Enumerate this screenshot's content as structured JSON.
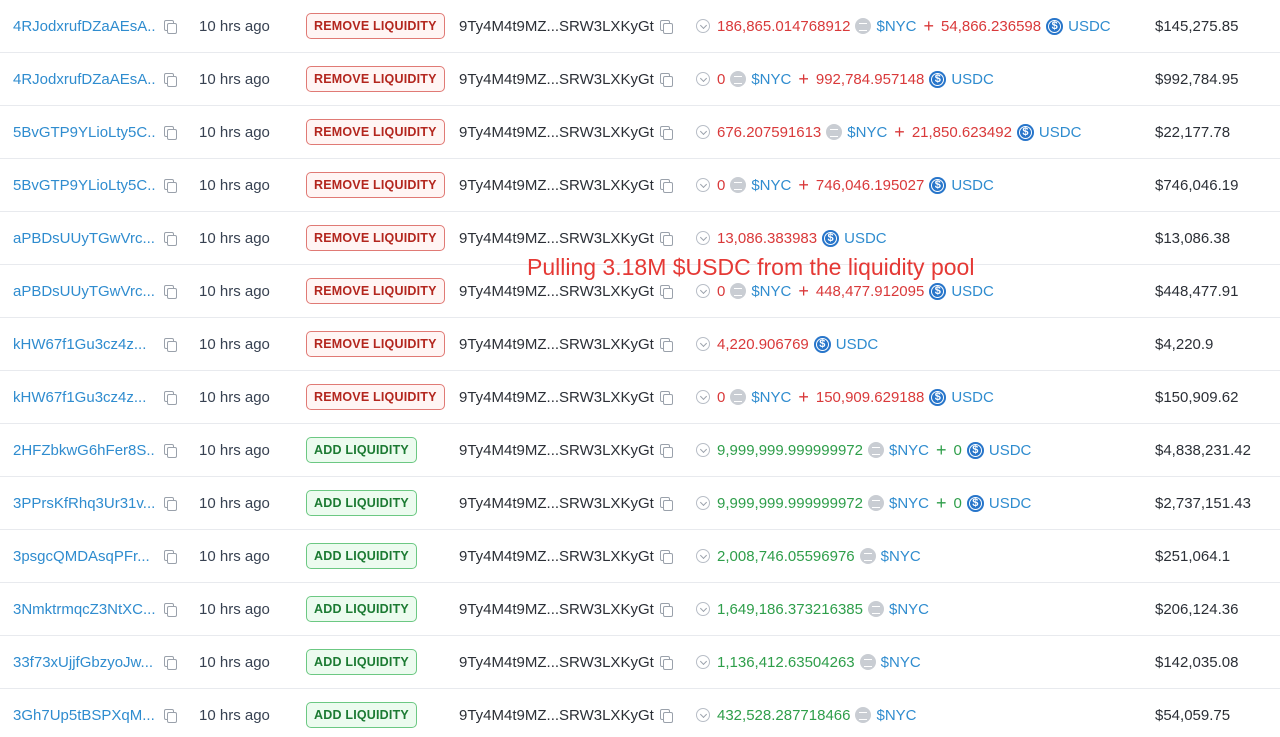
{
  "overlay_text": "Pulling 3.18M $USDC from the liquidity pool",
  "icons": {
    "copy": "copy-icon",
    "expand": "chevron-down-icon",
    "nyc_token": "nyc-token-icon",
    "usdc_token": "usdc-token-icon"
  },
  "colors": {
    "link": "#2f8ccf",
    "remove": "#b3261e",
    "add": "#1b7a32",
    "negative": "#d9393a",
    "positive": "#2e9e4a"
  },
  "rows": [
    {
      "sig": "4RJodxrufDZaAEsA...",
      "time": "10 hrs ago",
      "type": "REMOVE LIQUIDITY",
      "kind": "remove",
      "account": "9Ty4M4t9MZ...SRW3LXKyGt",
      "tokens": [
        {
          "amount": "186,865.014768912",
          "symbol": "$NYC",
          "icon": "nyc"
        },
        {
          "amount": "54,866.236598",
          "symbol": "USDC",
          "icon": "usdc"
        }
      ],
      "value": "$145,275.85"
    },
    {
      "sig": "4RJodxrufDZaAEsA...",
      "time": "10 hrs ago",
      "type": "REMOVE LIQUIDITY",
      "kind": "remove",
      "account": "9Ty4M4t9MZ...SRW3LXKyGt",
      "tokens": [
        {
          "amount": "0",
          "symbol": "$NYC",
          "icon": "nyc"
        },
        {
          "amount": "992,784.957148",
          "symbol": "USDC",
          "icon": "usdc"
        }
      ],
      "value": "$992,784.95"
    },
    {
      "sig": "5BvGTP9YLioLty5C...",
      "time": "10 hrs ago",
      "type": "REMOVE LIQUIDITY",
      "kind": "remove",
      "account": "9Ty4M4t9MZ...SRW3LXKyGt",
      "tokens": [
        {
          "amount": "676.207591613",
          "symbol": "$NYC",
          "icon": "nyc"
        },
        {
          "amount": "21,850.623492",
          "symbol": "USDC",
          "icon": "usdc"
        }
      ],
      "value": "$22,177.78"
    },
    {
      "sig": "5BvGTP9YLioLty5C...",
      "time": "10 hrs ago",
      "type": "REMOVE LIQUIDITY",
      "kind": "remove",
      "account": "9Ty4M4t9MZ...SRW3LXKyGt",
      "tokens": [
        {
          "amount": "0",
          "symbol": "$NYC",
          "icon": "nyc"
        },
        {
          "amount": "746,046.195027",
          "symbol": "USDC",
          "icon": "usdc"
        }
      ],
      "value": "$746,046.19"
    },
    {
      "sig": "aPBDsUUyTGwVrc...",
      "time": "10 hrs ago",
      "type": "REMOVE LIQUIDITY",
      "kind": "remove",
      "account": "9Ty4M4t9MZ...SRW3LXKyGt",
      "tokens": [
        {
          "amount": "13,086.383983",
          "symbol": "USDC",
          "icon": "usdc"
        }
      ],
      "value": "$13,086.38"
    },
    {
      "sig": "aPBDsUUyTGwVrc...",
      "time": "10 hrs ago",
      "type": "REMOVE LIQUIDITY",
      "kind": "remove",
      "account": "9Ty4M4t9MZ...SRW3LXKyGt",
      "tokens": [
        {
          "amount": "0",
          "symbol": "$NYC",
          "icon": "nyc"
        },
        {
          "amount": "448,477.912095",
          "symbol": "USDC",
          "icon": "usdc"
        }
      ],
      "value": "$448,477.91"
    },
    {
      "sig": "kHW67f1Gu3cz4z...",
      "time": "10 hrs ago",
      "type": "REMOVE LIQUIDITY",
      "kind": "remove",
      "account": "9Ty4M4t9MZ...SRW3LXKyGt",
      "tokens": [
        {
          "amount": "4,220.906769",
          "symbol": "USDC",
          "icon": "usdc"
        }
      ],
      "value": "$4,220.9"
    },
    {
      "sig": "kHW67f1Gu3cz4z...",
      "time": "10 hrs ago",
      "type": "REMOVE LIQUIDITY",
      "kind": "remove",
      "account": "9Ty4M4t9MZ...SRW3LXKyGt",
      "tokens": [
        {
          "amount": "0",
          "symbol": "$NYC",
          "icon": "nyc"
        },
        {
          "amount": "150,909.629188",
          "symbol": "USDC",
          "icon": "usdc"
        }
      ],
      "value": "$150,909.62"
    },
    {
      "sig": "2HFZbkwG6hFer8S...",
      "time": "10 hrs ago",
      "type": "ADD LIQUIDITY",
      "kind": "add",
      "account": "9Ty4M4t9MZ...SRW3LXKyGt",
      "tokens": [
        {
          "amount": "9,999,999.999999972",
          "symbol": "$NYC",
          "icon": "nyc"
        },
        {
          "amount": "0",
          "symbol": "USDC",
          "icon": "usdc"
        }
      ],
      "value": "$4,838,231.42"
    },
    {
      "sig": "3PPrsKfRhq3Ur31v...",
      "time": "10 hrs ago",
      "type": "ADD LIQUIDITY",
      "kind": "add",
      "account": "9Ty4M4t9MZ...SRW3LXKyGt",
      "tokens": [
        {
          "amount": "9,999,999.999999972",
          "symbol": "$NYC",
          "icon": "nyc"
        },
        {
          "amount": "0",
          "symbol": "USDC",
          "icon": "usdc"
        }
      ],
      "value": "$2,737,151.43"
    },
    {
      "sig": "3psgcQMDAsqPFr...",
      "time": "10 hrs ago",
      "type": "ADD LIQUIDITY",
      "kind": "add",
      "account": "9Ty4M4t9MZ...SRW3LXKyGt",
      "tokens": [
        {
          "amount": "2,008,746.05596976",
          "symbol": "$NYC",
          "icon": "nyc"
        }
      ],
      "value": "$251,064.1"
    },
    {
      "sig": "3NmktrmqcZ3NtXC...",
      "time": "10 hrs ago",
      "type": "ADD LIQUIDITY",
      "kind": "add",
      "account": "9Ty4M4t9MZ...SRW3LXKyGt",
      "tokens": [
        {
          "amount": "1,649,186.373216385",
          "symbol": "$NYC",
          "icon": "nyc"
        }
      ],
      "value": "$206,124.36"
    },
    {
      "sig": "33f73xUjjfGbzyoJw...",
      "time": "10 hrs ago",
      "type": "ADD LIQUIDITY",
      "kind": "add",
      "account": "9Ty4M4t9MZ...SRW3LXKyGt",
      "tokens": [
        {
          "amount": "1,136,412.63504263",
          "symbol": "$NYC",
          "icon": "nyc"
        }
      ],
      "value": "$142,035.08"
    },
    {
      "sig": "3Gh7Up5tBSPXqM...",
      "time": "10 hrs ago",
      "type": "ADD LIQUIDITY",
      "kind": "add",
      "account": "9Ty4M4t9MZ...SRW3LXKyGt",
      "tokens": [
        {
          "amount": "432,528.287718466",
          "symbol": "$NYC",
          "icon": "nyc"
        }
      ],
      "value": "$54,059.75"
    }
  ]
}
